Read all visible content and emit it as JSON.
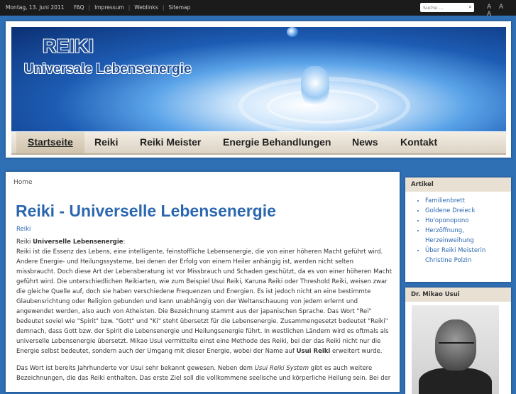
{
  "topbar": {
    "date": "Montag, 13. Juni 2011",
    "links": [
      "FAQ",
      "Impressum",
      "Weblinks",
      "Sitemap"
    ],
    "search_placeholder": "Suche ...",
    "font_controls": "A A A"
  },
  "header": {
    "title": "REIKI",
    "subtitle": "Universale Lebensenergie"
  },
  "nav": {
    "items": [
      "Startseite",
      "Reiki",
      "Reiki Meister",
      "Energie Behandlungen",
      "News",
      "Kontakt"
    ],
    "active": "Startseite"
  },
  "content": {
    "breadcrumb": "Home",
    "title": "Reiki - Universelle Lebensenergie",
    "category": "Reiki",
    "intro_label": "Reiki ",
    "intro_bold": "Universelle Lebensenergie",
    "intro_colon": ":",
    "paragraph1": "Reiki ist die Essenz des Lebens, eine intelligente, feinstoffliche Lebensenergie, die von einer höheren Macht geführt wird. Andere Energie- und Heilungssysteme, bei denen der Erfolg von einem Heiler anhängig ist, werden nicht selten missbraucht. Doch diese Art der Lebensberatung ist vor Missbrauch und Schaden geschützt, da es von einer höheren Macht geführt wird. Die unterschiedlichen Reikiarten, wie zum Beispiel Usui Reiki, Karuna Reiki oder Threshold Reiki, weisen zwar die gleiche Quelle auf, doch sie haben verschiedene Frequenzen und Energien. Es ist jedoch nicht an eine bestimmte Glaubensrichtung oder Religion gebunden und kann unabhängig von der Weltanschauung von jedem erlernt und angewendet werden, also auch von Atheisten. Die Bezeichnung stammt aus der japanischen Sprache. Das Wort \"Rei\" bedeutet soviel wie \"Spirit\" bzw. \"Gott\" und \"Ki\" steht übersetzt für die Lebensenergie. Zusammengesetzt bedeutet \"Reiki\" demnach, dass Gott bzw. der Spirit die Lebensenergie und Heilungsenergie führt. In westlichen Ländern wird es oftmals als universelle Lebensenergie übersetzt. Mikao Usui vermittelte einst eine Methode des Reiki, bei der das Reiki nicht nur die Energie selbst bedeutet, sondern auch der Umgang mit dieser Energie, wobei der Name auf ",
    "paragraph1_bold": "Usui Reiki",
    "paragraph1_end": " erweitert wurde.",
    "paragraph2_start": "Das Wort ist bereits Jahrhunderte vor Usui sehr bekannt gewesen. Neben dem ",
    "paragraph2_italic": "Usui Reiki System",
    "paragraph2_end": " gibt es auch weitere Bezeichnungen, die das Reiki enthalten. Das erste Ziel soll die vollkommene seelische und körperliche Heilung sein. Bei der"
  },
  "sidebar": {
    "articles_title": "Artikel",
    "articles": [
      "Familienbrett",
      "Goldene Dreieck",
      "Ho'oponopono",
      "Herzöffnung, Herzeinweihung",
      "Über Reiki Meisterin Christine Polzin"
    ],
    "portrait_title": "Dr. Mikao Usui"
  },
  "colors": {
    "background": "#2f6fb4",
    "accent": "#2b67b0",
    "topbar": "#1b1b1b",
    "nav": "#dcd3c4"
  }
}
